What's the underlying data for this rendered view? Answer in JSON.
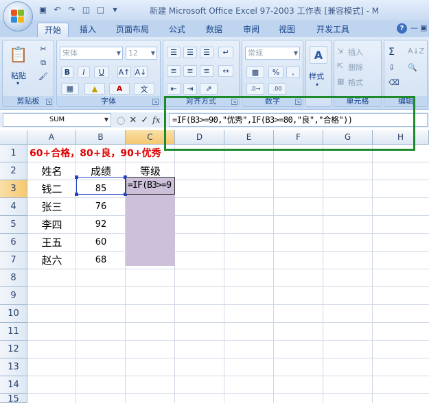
{
  "window": {
    "title": "新建 Microsoft Office Excel 97-2003 工作表 [兼容模式] - M",
    "qat_icons": [
      "save-icon",
      "undo-icon",
      "redo-icon",
      "print-preview-icon",
      "new-icon"
    ]
  },
  "ribbon": {
    "tabs": [
      "开始",
      "插入",
      "页面布局",
      "公式",
      "数据",
      "审阅",
      "视图",
      "开发工具"
    ],
    "active_tab": "开始",
    "groups": {
      "clipboard": {
        "label": "剪贴板",
        "paste_label": "粘贴"
      },
      "font": {
        "label": "字体",
        "font_name": "宋体",
        "font_size": "12"
      },
      "alignment": {
        "label": "对齐方式"
      },
      "number": {
        "label": "数字",
        "format": "常规"
      },
      "styles": {
        "label": "",
        "styles_label": "样式"
      },
      "cells": {
        "label": "单元格",
        "insert": "插入",
        "delete": "删除",
        "format": "格式"
      },
      "editing": {
        "label": "编辑"
      }
    }
  },
  "formula_bar": {
    "name_box": "SUM",
    "formula": "=IF(B3>=90,\"优秀\",IF(B3>=80,\"良\",\"合格\"))"
  },
  "sheet": {
    "columns": [
      "A",
      "B",
      "C",
      "D",
      "E",
      "F",
      "G",
      "H"
    ],
    "rows": [
      "1",
      "2",
      "3",
      "4",
      "5",
      "6",
      "7",
      "8",
      "9",
      "10",
      "11",
      "12",
      "13",
      "14",
      "15"
    ],
    "selected_column": "C",
    "selected_row": "3",
    "note": "60+合格，80+良，90+优秀",
    "headers": {
      "name": "姓名",
      "score": "成绩",
      "grade": "等级"
    },
    "records": [
      {
        "name": "钱二",
        "score": "85"
      },
      {
        "name": "张三",
        "score": "76"
      },
      {
        "name": "李四",
        "score": "92"
      },
      {
        "name": "王五",
        "score": "60"
      },
      {
        "name": "赵六",
        "score": "68"
      }
    ],
    "editing_cell_text": "=IF(B3>=9",
    "fill_color": "#ccc0da",
    "highlight_color": "#1d8a2b"
  }
}
